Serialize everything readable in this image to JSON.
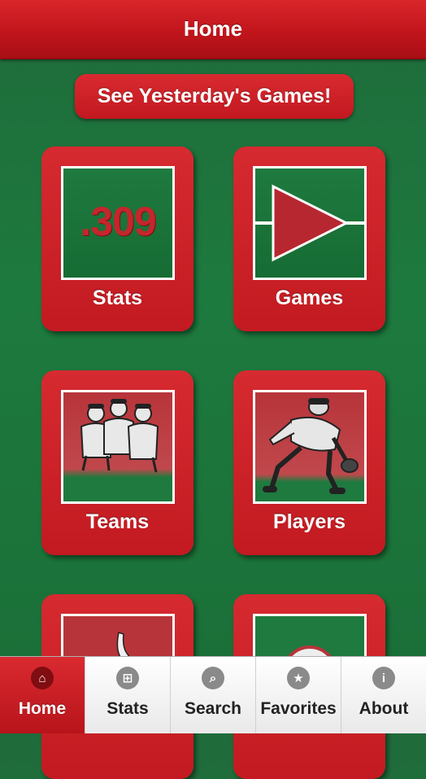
{
  "header": {
    "title": "Home"
  },
  "banner": {
    "label": "See Yesterday's Games!"
  },
  "tiles": {
    "stats": {
      "label": "Stats",
      "number": ".309"
    },
    "games": {
      "label": "Games"
    },
    "teams": {
      "label": "Teams"
    },
    "players": {
      "label": "Players"
    }
  },
  "tabs": [
    {
      "label": "Home",
      "icon": "home-icon",
      "active": true
    },
    {
      "label": "Stats",
      "icon": "grid-icon",
      "active": false
    },
    {
      "label": "Search",
      "icon": "search-icon",
      "active": false
    },
    {
      "label": "Favorites",
      "icon": "star-icon",
      "active": false
    },
    {
      "label": "About",
      "icon": "info-icon",
      "active": false
    }
  ],
  "colors": {
    "brand_red": "#c8191f",
    "field_green": "#1d7a3e"
  }
}
